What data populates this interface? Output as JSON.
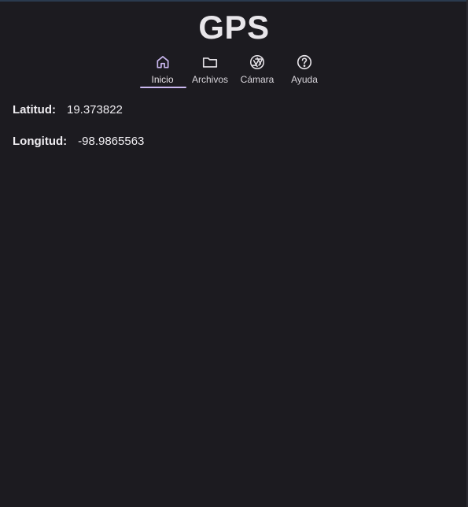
{
  "app": {
    "title": "GPS"
  },
  "tabs": [
    {
      "label": "Inicio",
      "icon": "home-icon",
      "active": true
    },
    {
      "label": "Archivos",
      "icon": "folder-icon",
      "active": false
    },
    {
      "label": "Cámara",
      "icon": "camera-shutter-icon",
      "active": false
    },
    {
      "label": "Ayuda",
      "icon": "help-circle-icon",
      "active": false
    }
  ],
  "location": {
    "latitude_label": "Latitud:",
    "latitude_value": "19.373822",
    "longitude_label": "Longitud:",
    "longitude_value": "-98.9865563"
  },
  "colors": {
    "background": "#1c1b20",
    "accent": "#cbb8f0",
    "text": "#e6e1e5"
  }
}
